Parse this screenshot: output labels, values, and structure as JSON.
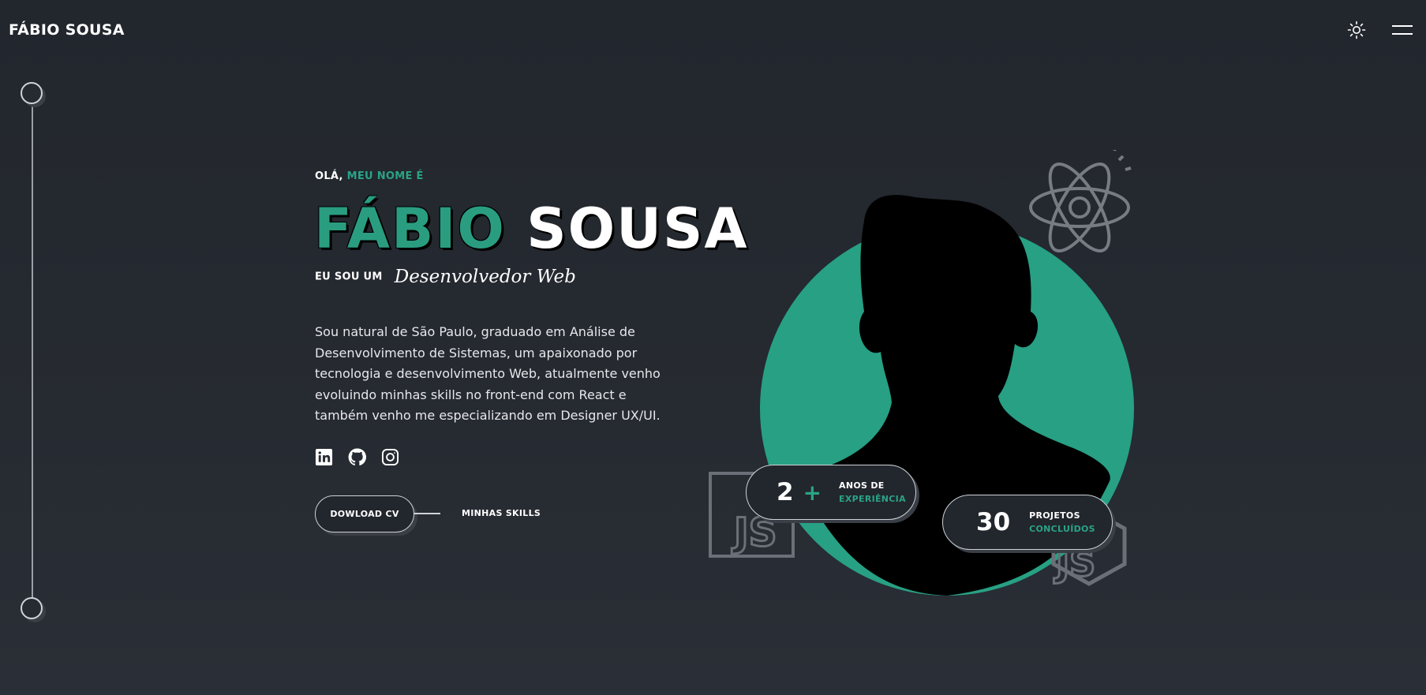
{
  "header": {
    "logo": "FÁBIO SOUSA",
    "theme_icon": "sun-icon",
    "menu_icon": "hamburger-menu-icon"
  },
  "hero": {
    "greeting_prefix": "OLÁ,",
    "greeting_accent": "MEU NOME É",
    "first_name": "FÁBIO",
    "last_name": "SOUSA",
    "role_prefix": "EU SOU UM",
    "role_title": "Desenvolvedor Web",
    "bio": "Sou natural de São Paulo, graduado em Análise de Desenvolvimento de Sistemas, um apaixonado por tecnologia e desenvolvimento Web, atualmente venho evoluindo minhas skills no front-end com React e também venho me especializando em Designer UX/UI.",
    "socials": [
      {
        "icon": "linkedin-icon"
      },
      {
        "icon": "github-icon"
      },
      {
        "icon": "instagram-icon"
      }
    ],
    "cv_button": "DOWLOAD CV",
    "skills_link": "MINHAS SKILLS"
  },
  "stats": {
    "experience": {
      "value": "2",
      "plus": "+",
      "label_top": "ANOS DE",
      "label_bottom": "EXPERIÊNCIA"
    },
    "projects": {
      "value": "30",
      "label_top": "PROJETOS",
      "label_bottom": "CONCLUÍDOS"
    }
  },
  "colors": {
    "background": "#262a31",
    "accent": "#2a9d80",
    "text": "#ffffff"
  }
}
